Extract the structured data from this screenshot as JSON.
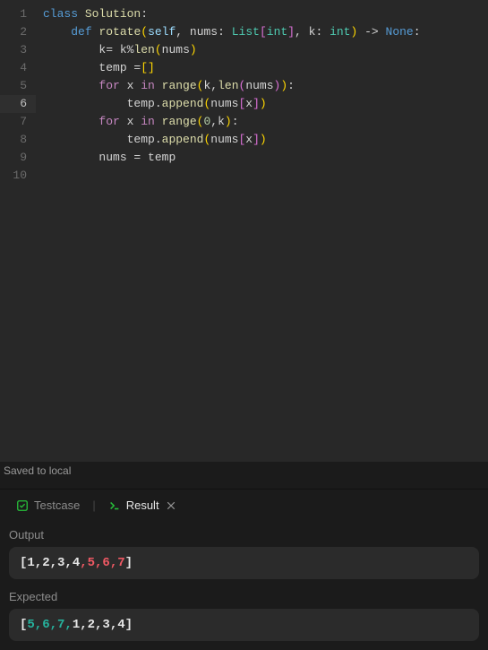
{
  "editor": {
    "lines": [
      {
        "n": 1,
        "html": "<span class='kw2'>class</span> <span class='cls'>Solution</span><span class='pn'>:</span>"
      },
      {
        "n": 2,
        "html": "    <span class='kw2'>def</span> <span class='fn'>rotate</span><span class='br1'>(</span><span class='self'>self</span><span class='pn'>,</span> <span class='param'>nums</span><span class='pn'>:</span> <span class='type'>List</span><span class='br2'>[</span><span class='type'>int</span><span class='br2'>]</span><span class='pn'>,</span> <span class='param'>k</span><span class='pn'>:</span> <span class='type'>int</span><span class='br1'>)</span> <span class='op'>-&gt;</span> <span class='kw2'>None</span><span class='pn'>:</span>"
      },
      {
        "n": 3,
        "html": "        k<span class='op'>=</span> k<span class='op'>%</span><span class='fn'>len</span><span class='br1'>(</span>nums<span class='br1'>)</span>"
      },
      {
        "n": 4,
        "html": "        temp <span class='op'>=</span><span class='br1'>[</span><span class='br1'>]</span>"
      },
      {
        "n": 5,
        "html": "        <span class='kw'>for</span> x <span class='kw'>in</span> <span class='fn'>range</span><span class='br1'>(</span>k<span class='pn'>,</span><span class='fn'>len</span><span class='br2'>(</span>nums<span class='br2'>)</span><span class='br1'>)</span><span class='pn'>:</span>"
      },
      {
        "n": 6,
        "html": "            temp<span class='pn'>.</span><span class='fn'>append</span><span class='br1'>(</span>nums<span class='br2'>[</span>x<span class='br2'>]</span><span class='br1'>)</span>",
        "current": true
      },
      {
        "n": 7,
        "html": "        <span class='kw'>for</span> x <span class='kw'>in</span> <span class='fn'>range</span><span class='br1'>(</span><span class='num'>0</span><span class='pn'>,</span>k<span class='br1'>)</span><span class='pn'>:</span>"
      },
      {
        "n": 8,
        "html": "            temp<span class='pn'>.</span><span class='fn'>append</span><span class='br1'>(</span>nums<span class='br2'>[</span>x<span class='br2'>]</span><span class='br1'>)</span>"
      },
      {
        "n": 9,
        "html": "        nums <span class='op'>=</span> temp"
      },
      {
        "n": 10,
        "html": ""
      }
    ]
  },
  "status": {
    "text": "Saved to local"
  },
  "tabs": {
    "testcase": "Testcase",
    "result": "Result"
  },
  "output": {
    "label": "Output",
    "open": "[",
    "close": "]",
    "tokens": [
      {
        "text": "1,2,3,4",
        "cls": "tok-common"
      },
      {
        "text": ",5,6,7",
        "cls": "tok-wrong"
      }
    ]
  },
  "expected": {
    "label": "Expected",
    "open": "[",
    "close": "]",
    "tokens": [
      {
        "text": "5,6,7,",
        "cls": "tok-right"
      },
      {
        "text": "1,2,3,4",
        "cls": "tok-common"
      }
    ]
  }
}
